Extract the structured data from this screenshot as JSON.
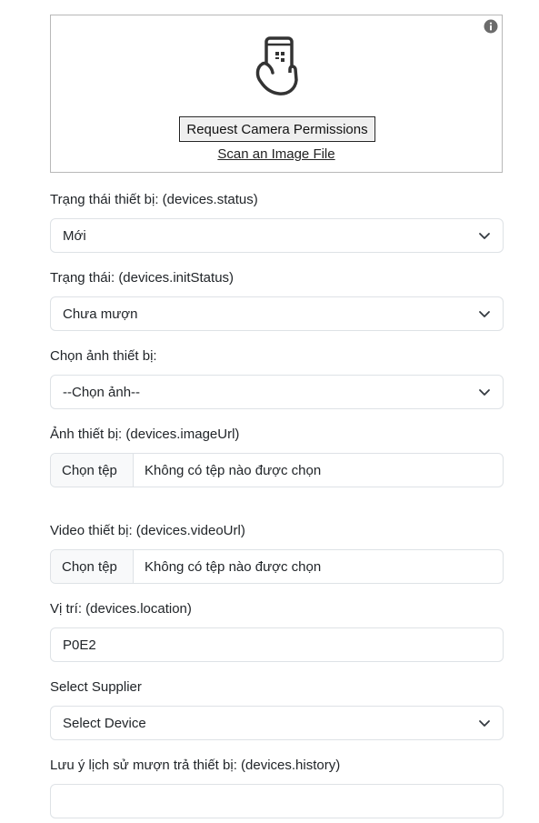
{
  "scanner": {
    "info_icon": "info-circle-icon",
    "phone_icon": "phone-qr-scan-icon",
    "camera_button": "Request Camera Permissions",
    "scan_file_link": "Scan an Image File"
  },
  "form": {
    "status": {
      "label": "Trạng thái thiết bị: (devices.status)",
      "value": "Mới"
    },
    "init_status": {
      "label": "Trạng thái: (devices.initStatus)",
      "value": "Chưa mượn"
    },
    "choose_image": {
      "label": "Chọn ảnh thiết bị:",
      "value": "--Chọn ảnh--"
    },
    "image_url": {
      "label": "Ảnh thiết bị: (devices.imageUrl)",
      "button": "Chọn tệp",
      "file_name": "Không có tệp nào được chọn"
    },
    "video_url": {
      "label": "Video thiết bị: (devices.videoUrl)",
      "button": "Chọn tệp",
      "file_name": "Không có tệp nào được chọn"
    },
    "location": {
      "label": "Vị trí: (devices.location)",
      "value": "P0E2"
    },
    "supplier": {
      "label": "Select Supplier",
      "value": "Select Device"
    },
    "history": {
      "label": "Lưu ý lịch sử mượn trả thiết bị: (devices.history)",
      "value": ""
    }
  }
}
